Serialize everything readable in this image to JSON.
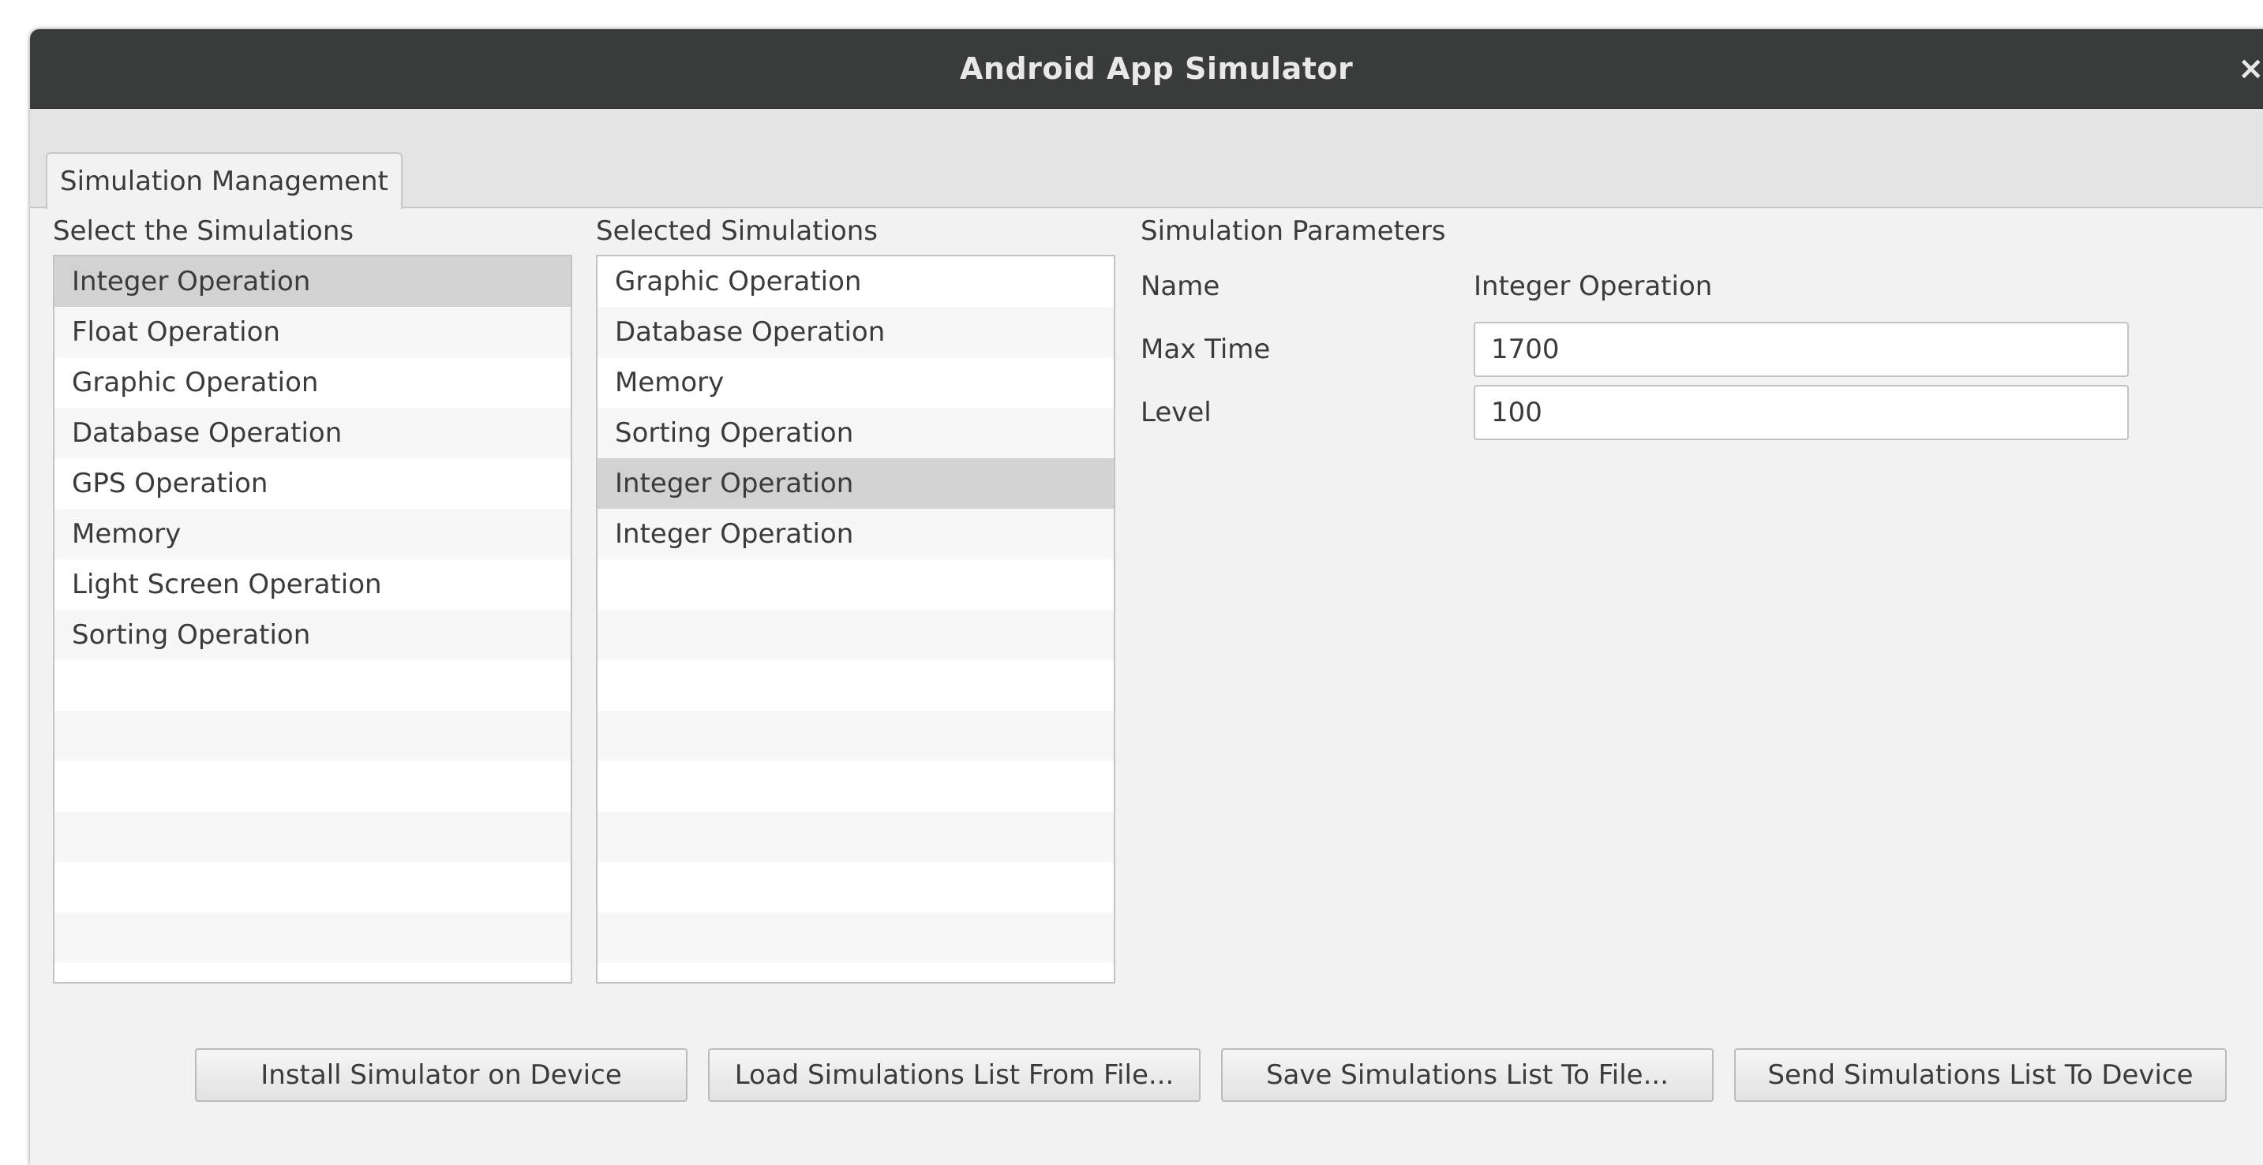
{
  "window": {
    "title": "Android App Simulator",
    "close_glyph": "×"
  },
  "tabs": [
    {
      "label": "Simulation Management",
      "active": true
    }
  ],
  "available": {
    "heading": "Select the Simulations",
    "items": [
      "Integer Operation",
      "Float Operation",
      "Graphic Operation",
      "Database Operation",
      "GPS Operation",
      "Memory",
      "Light Screen Operation",
      "Sorting Operation"
    ],
    "selected_index": 0
  },
  "selected": {
    "heading": "Selected Simulations",
    "items": [
      "Graphic Operation",
      "Database Operation",
      "Memory",
      "Sorting Operation",
      "Integer Operation",
      "Integer Operation"
    ],
    "selected_index": 4
  },
  "parameters": {
    "heading": "Simulation Parameters",
    "name_label": "Name",
    "name_value": "Integer Operation",
    "max_time_label": "Max Time",
    "max_time_value": "1700",
    "level_label": "Level",
    "level_value": "100"
  },
  "buttons": {
    "install": "Install Simulator on Device",
    "load": "Load Simulations List From File...",
    "save": "Save Simulations List To File...",
    "send": "Send Simulations List To Device"
  },
  "colors": {
    "titlebar": "#3a3c3b",
    "selection": "#d2d2d2",
    "window_bg": "#f2f2f2"
  }
}
